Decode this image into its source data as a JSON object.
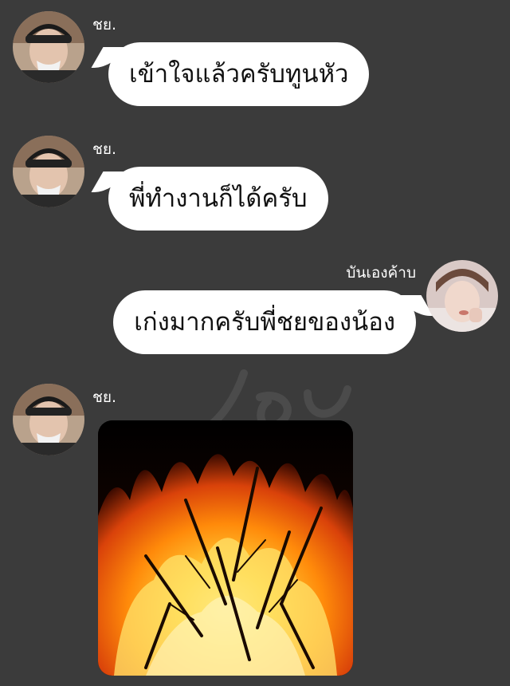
{
  "messages": [
    {
      "sender": "ชย.",
      "side": "left",
      "text": "เข้าใจแล้วครับทูนหัว"
    },
    {
      "sender": "ชย.",
      "side": "left",
      "text": "พี่ทำงานก็ได้ครับ"
    },
    {
      "sender": "บันเองค้าบ",
      "side": "right",
      "text": "เก่งมากครับพี่ชยของน้อง"
    },
    {
      "sender": "ชย.",
      "side": "left",
      "image": "bonfire-photo"
    }
  ],
  "colors": {
    "background": "#3b3b3b",
    "bubble": "#ffffff",
    "text": "#111111",
    "sender_text": "#ffffff"
  }
}
